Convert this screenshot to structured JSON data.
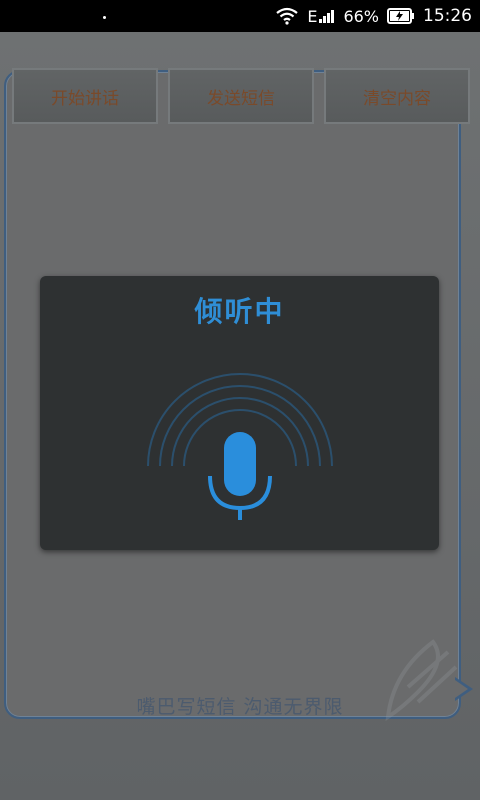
{
  "status_bar": {
    "network": "E",
    "battery": "66%",
    "time": "15:26"
  },
  "slogan": "嘴巴写短信 沟通无界限",
  "dialog": {
    "title": "倾听中"
  },
  "toolbar": {
    "start_label": "开始讲话",
    "send_label": "发送短信",
    "clear_label": "清空内容"
  },
  "colors": {
    "accent": "#2f8ed6",
    "button_text": "#7a4a2a",
    "bubble_border": "#3f5e80"
  }
}
